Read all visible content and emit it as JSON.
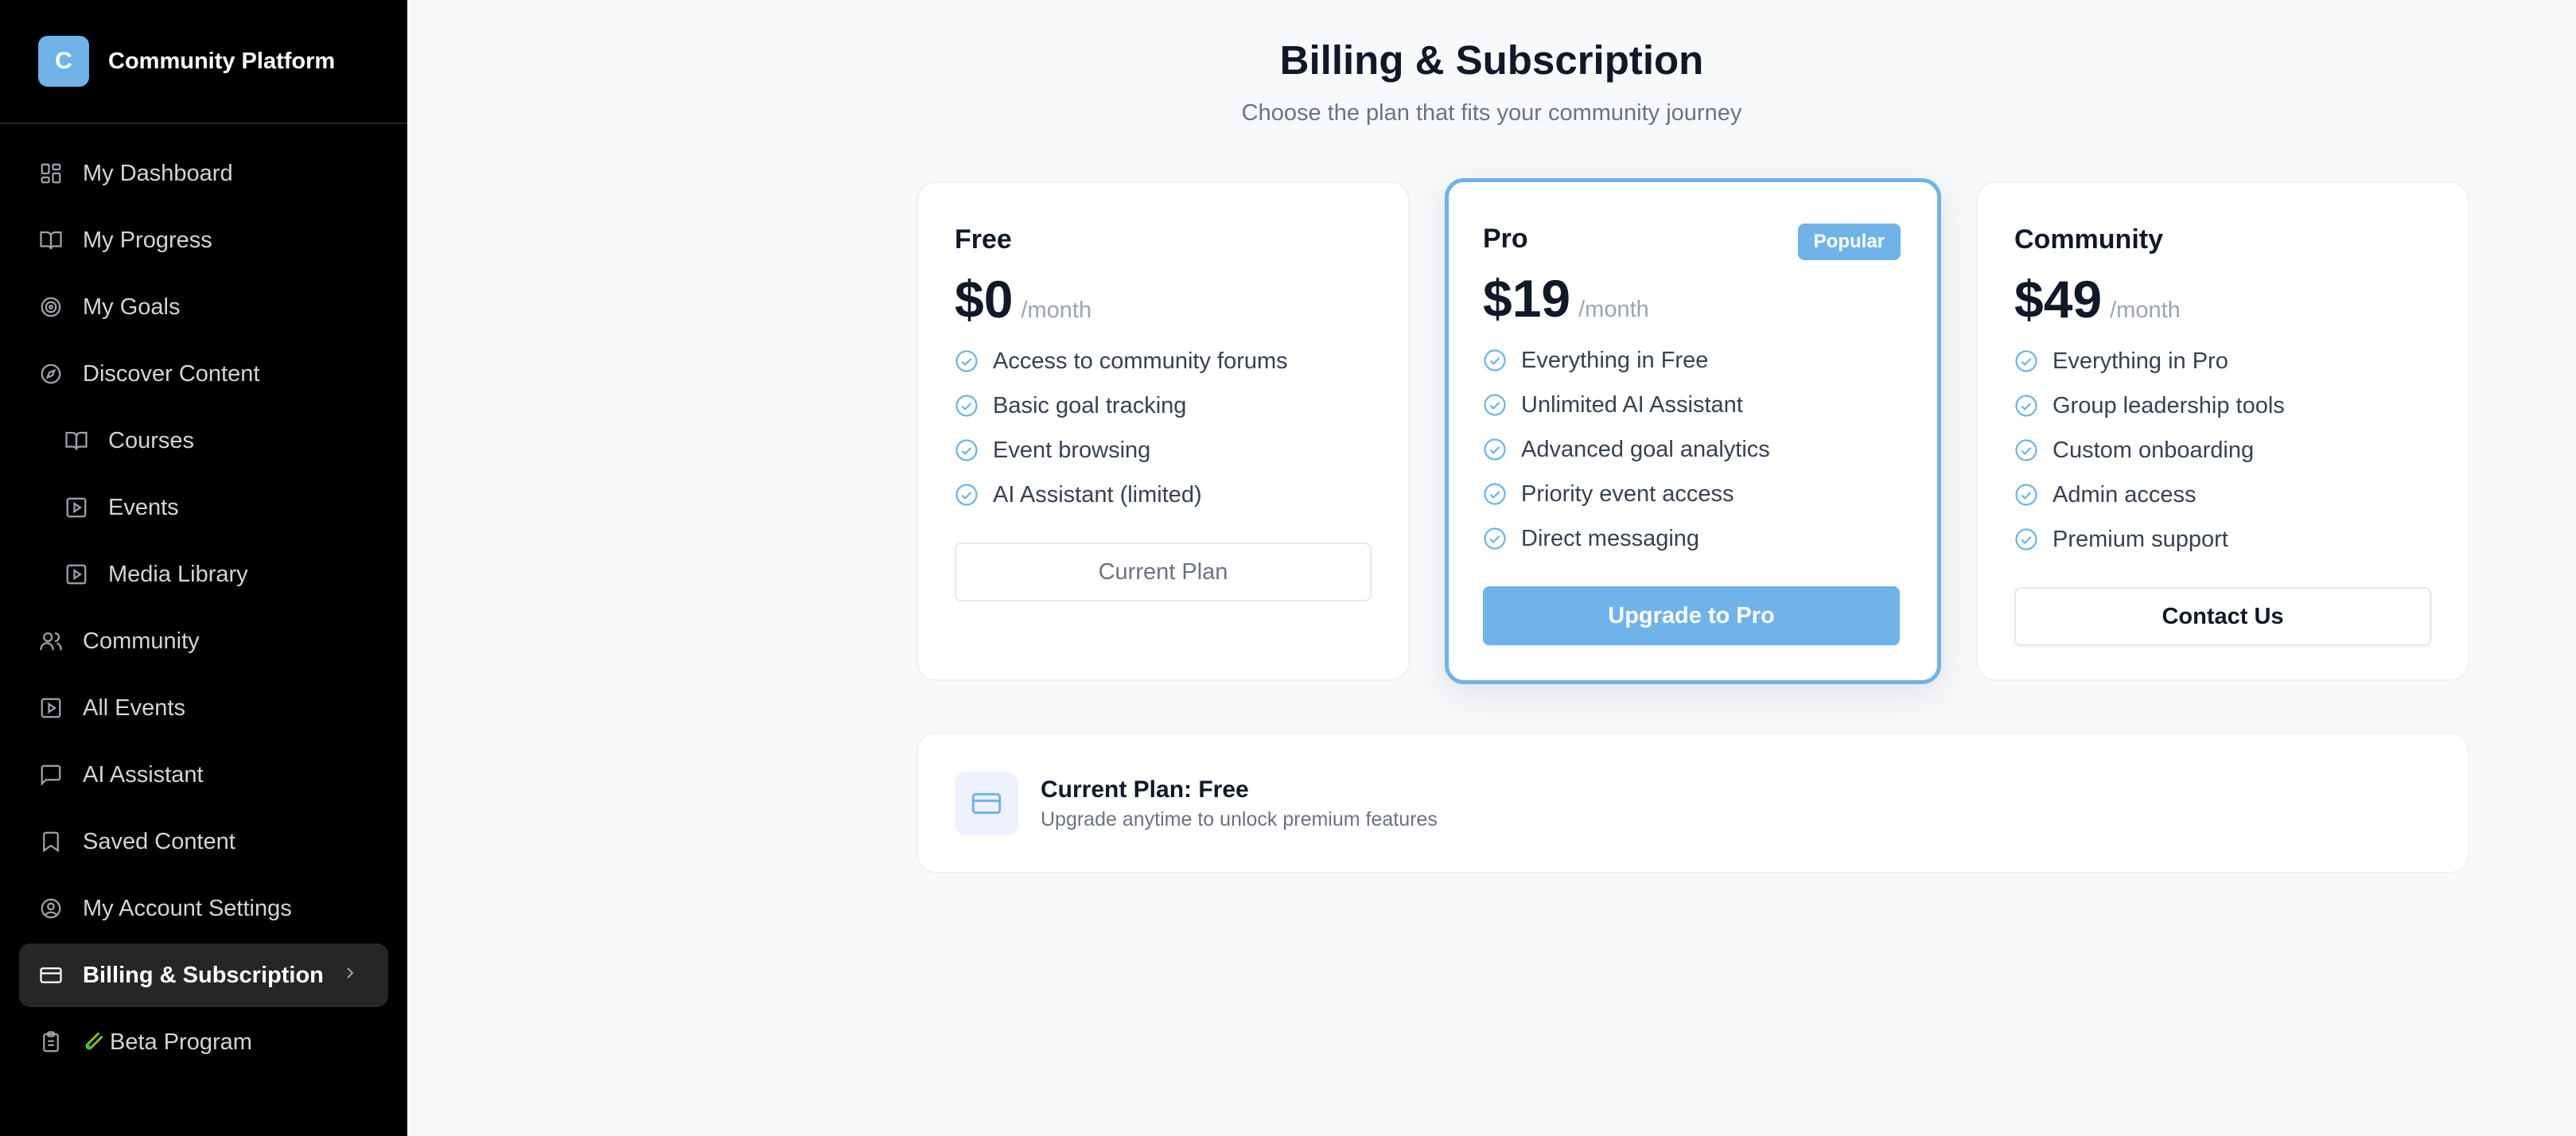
{
  "brand": {
    "logo_letter": "C",
    "name": "Community Platform",
    "accent": "#6fb3e8"
  },
  "sidebar": {
    "items": [
      {
        "label": "My Dashboard",
        "icon": "dashboard-icon"
      },
      {
        "label": "My Progress",
        "icon": "book-open-icon"
      },
      {
        "label": "My Goals",
        "icon": "target-icon"
      },
      {
        "label": "Discover Content",
        "icon": "compass-icon"
      },
      {
        "label": "Courses",
        "icon": "book-open-icon",
        "sub": true
      },
      {
        "label": "Events",
        "icon": "play-square-icon",
        "sub": true
      },
      {
        "label": "Media Library",
        "icon": "play-square-icon",
        "sub": true
      },
      {
        "label": "Community",
        "icon": "users-icon"
      },
      {
        "label": "All Events",
        "icon": "play-square-icon"
      },
      {
        "label": "AI Assistant",
        "icon": "message-square-icon"
      },
      {
        "label": "Saved Content",
        "icon": "bookmark-icon"
      },
      {
        "label": "My Account Settings",
        "icon": "user-circle-icon"
      },
      {
        "label": "Billing & Subscription",
        "icon": "credit-card-icon",
        "active": true
      },
      {
        "label": "Beta Program",
        "icon": "clipboard-icon",
        "prefix_icon": "test-tube-icon"
      }
    ]
  },
  "header": {
    "title": "Billing & Subscription",
    "subtitle": "Choose the plan that fits your community journey"
  },
  "plans": [
    {
      "name": "Free",
      "price": "$0",
      "period": "/month",
      "features": [
        "Access to community forums",
        "Basic goal tracking",
        "Event browsing",
        "AI Assistant (limited)"
      ],
      "button": "Current Plan"
    },
    {
      "name": "Pro",
      "badge": "Popular",
      "price": "$19",
      "period": "/month",
      "features": [
        "Everything in Free",
        "Unlimited AI Assistant",
        "Advanced goal analytics",
        "Priority event access",
        "Direct messaging"
      ],
      "button": "Upgrade to Pro"
    },
    {
      "name": "Community",
      "price": "$49",
      "period": "/month",
      "features": [
        "Everything in Pro",
        "Group leadership tools",
        "Custom onboarding",
        "Admin access",
        "Premium support"
      ],
      "button": "Contact Us"
    }
  ],
  "current_plan": {
    "title": "Current Plan: Free",
    "subtitle": "Upgrade anytime to unlock premium features"
  }
}
